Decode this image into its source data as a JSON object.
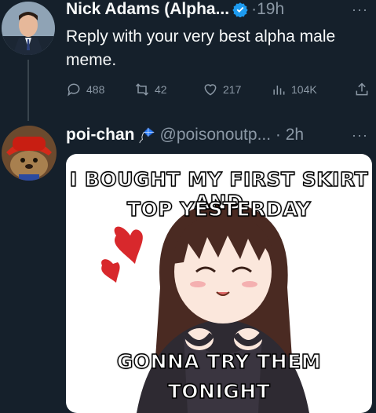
{
  "tweet1": {
    "display_name": "Nick Adams (Alpha...",
    "time": "·19h",
    "more": "···",
    "text": "Reply with your very best alpha male meme.",
    "replies": "488",
    "retweets": "42",
    "likes": "217",
    "views": "104K"
  },
  "tweet2": {
    "display_name": "poi-chan",
    "handle_time": "@poisonoutp... · 2h",
    "more": "···",
    "meme": {
      "top_line1": "I BOUGHT MY FIRST SKIRT AND",
      "top_line2": "TOP YESTERDAY",
      "bottom_line1": "GONNA TRY THEM",
      "bottom_line2": "TONIGHT"
    }
  },
  "colors": {
    "background": "#15202b",
    "text": "#f7f9f9",
    "muted": "#8b98a5",
    "verified": "#1d9bf0"
  },
  "icons": [
    "reply-icon",
    "retweet-icon",
    "like-icon",
    "views-icon",
    "share-icon",
    "verified-icon",
    "kite-icon"
  ]
}
